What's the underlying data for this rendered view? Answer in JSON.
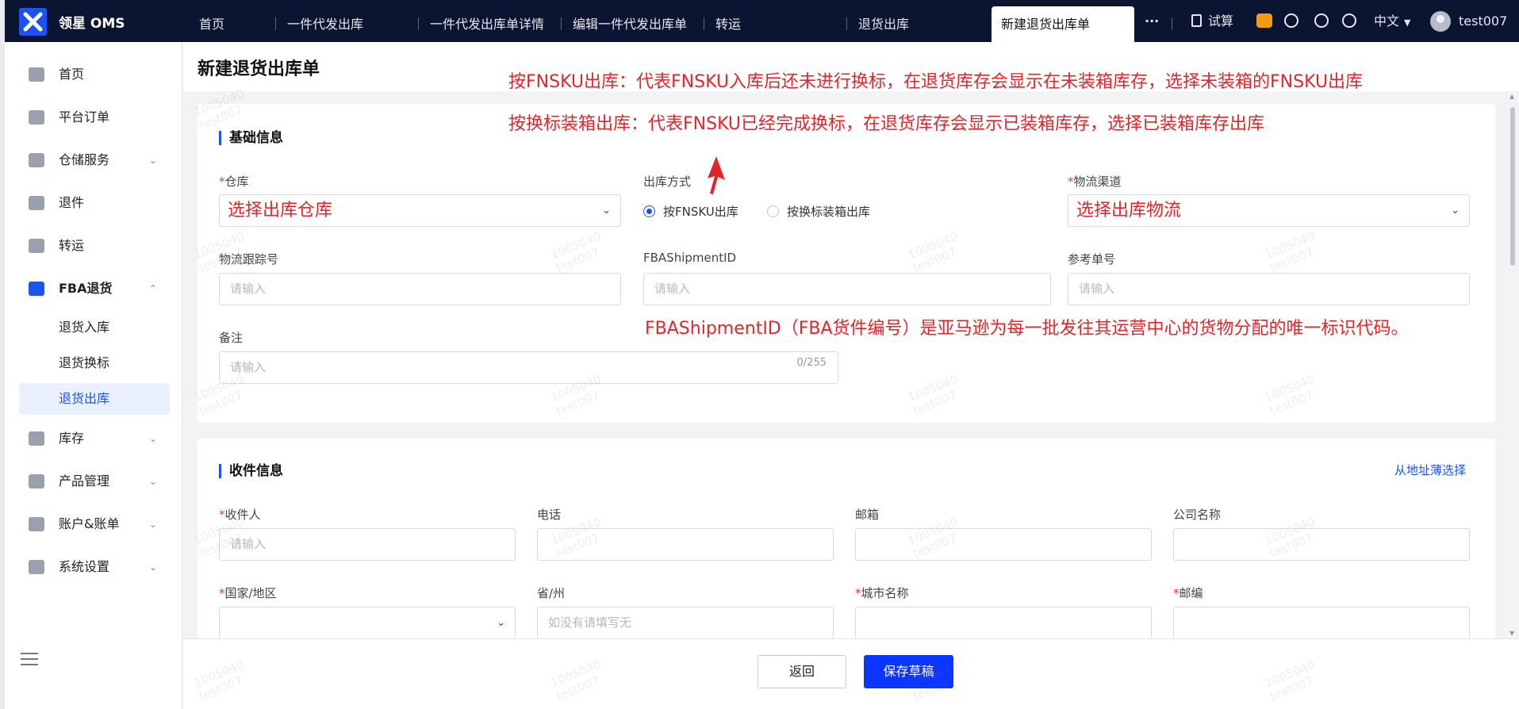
{
  "app": {
    "brand": "领星 OMS"
  },
  "tabs": [
    {
      "label": "首页"
    },
    {
      "label": "一件代发出库"
    },
    {
      "label": "一件代发出库单详情"
    },
    {
      "label": "编辑一件代发出库单"
    },
    {
      "label": "转运"
    },
    {
      "label": "退货出库"
    },
    {
      "label": "新建退货出库单"
    }
  ],
  "topright": {
    "more": "···",
    "trial": "试算",
    "language": "中文",
    "username": "test007"
  },
  "sidebar": {
    "items": [
      {
        "label": "首页",
        "icon": "home-icon"
      },
      {
        "label": "平台订单",
        "icon": "order-icon"
      },
      {
        "label": "仓储服务",
        "icon": "warehouse-icon"
      },
      {
        "label": "退件",
        "icon": "return-icon"
      },
      {
        "label": "转运",
        "icon": "transfer-icon"
      },
      {
        "label": "FBA退货",
        "icon": "amazon-icon"
      },
      {
        "label": "库存",
        "icon": "inventory-icon"
      },
      {
        "label": "产品管理",
        "icon": "product-icon"
      },
      {
        "label": "账户&账单",
        "icon": "billing-icon"
      },
      {
        "label": "系统设置",
        "icon": "settings-icon"
      }
    ],
    "subitems": [
      {
        "label": "退货入库"
      },
      {
        "label": "退货换标"
      },
      {
        "label": "退货出库"
      }
    ]
  },
  "page": {
    "title": "新建退货出库单"
  },
  "basic": {
    "title": "基础信息",
    "warehouse_label": "仓库",
    "warehouse_value": "选择出库仓库",
    "method_label": "出库方式",
    "method_opt1": "按FNSKU出库",
    "method_opt2": "按换标装箱出库",
    "channel_label": "物流渠道",
    "channel_value": "选择出库物流",
    "tracking_label": "物流跟踪号",
    "fba_label": "FBAShipmentID",
    "ref_label": "参考单号",
    "placeholder": "请输入",
    "remark_label": "备注",
    "remark_count": "0/255"
  },
  "receiver": {
    "title": "收件信息",
    "address_book_link": "从地址薄选择",
    "name_label": "收件人",
    "phone_label": "电话",
    "email_label": "邮箱",
    "company_label": "公司名称",
    "country_label": "国家/地区",
    "province_label": "省/州",
    "province_placeholder": "如没有请填写无",
    "city_label": "城市名称",
    "zip_label": "邮编",
    "placeholder": "请输入"
  },
  "annotations": {
    "a1": "按FNSKU出库：代表FNSKU入库后还未进行换标，在退货库存会显示在未装箱库存，选择未装箱的FNSKU出库",
    "a2": "按换标装箱出库：代表FNSKU已经完成换标，在退货库存会显示已装箱库存，选择已装箱库存出库",
    "a3": "FBAShipmentID（FBA货件编号）是亚马逊为每一批发往其运营中心的货物分配的唯一标识代码。"
  },
  "footer": {
    "back": "返回",
    "save_draft": "保存草稿"
  },
  "watermark": {
    "line1": "1005040",
    "line2": "test007"
  },
  "colors": {
    "accent": "#1b52f0",
    "annotation": "#e0262a",
    "topbar": "#0b1430"
  }
}
